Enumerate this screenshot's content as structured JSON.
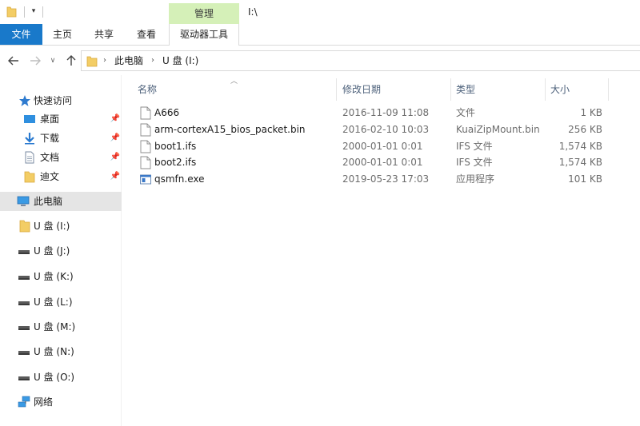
{
  "titlebar": {
    "context_tab_label": "管理",
    "path_title": "I:\\"
  },
  "ribbon": {
    "tabs": [
      {
        "label": "文件"
      },
      {
        "label": "主页"
      },
      {
        "label": "共享"
      },
      {
        "label": "查看"
      },
      {
        "label": "驱动器工具"
      }
    ]
  },
  "address": {
    "segments": [
      "此电脑",
      "U 盘 (I:)"
    ]
  },
  "sidebar": {
    "quick_access": {
      "label": "快速访问"
    },
    "pinned": [
      {
        "label": "桌面",
        "icon": "desktop-icon"
      },
      {
        "label": "下载",
        "icon": "download-icon"
      },
      {
        "label": "文档",
        "icon": "document-icon"
      },
      {
        "label": "迪文",
        "icon": "folder-icon"
      }
    ],
    "this_pc": {
      "label": "此电脑"
    },
    "drives": [
      {
        "label": "U 盘 (I:)",
        "icon": "folder-icon"
      },
      {
        "label": "U 盘 (J:)",
        "icon": "drive-icon"
      },
      {
        "label": "U 盘 (K:)",
        "icon": "drive-icon"
      },
      {
        "label": "U 盘 (L:)",
        "icon": "drive-icon"
      },
      {
        "label": "U 盘 (M:)",
        "icon": "drive-icon"
      },
      {
        "label": "U 盘 (N:)",
        "icon": "drive-icon"
      },
      {
        "label": "U 盘 (O:)",
        "icon": "drive-icon"
      }
    ],
    "network": {
      "label": "网络"
    }
  },
  "file_list": {
    "columns": {
      "name": "名称",
      "modified": "修改日期",
      "type": "类型",
      "size": "大小"
    },
    "rows": [
      {
        "name": "A666",
        "modified": "2016-11-09 11:08",
        "type": "文件",
        "size": "1 KB",
        "icon": "file-icon"
      },
      {
        "name": "arm-cortexA15_bios_packet.bin",
        "modified": "2016-02-10 10:03",
        "type": "KuaiZipMount.bin",
        "size": "256 KB",
        "icon": "file-icon"
      },
      {
        "name": "boot1.ifs",
        "modified": "2000-01-01 0:01",
        "type": "IFS 文件",
        "size": "1,574 KB",
        "icon": "file-icon"
      },
      {
        "name": "boot2.ifs",
        "modified": "2000-01-01 0:01",
        "type": "IFS 文件",
        "size": "1,574 KB",
        "icon": "file-icon"
      },
      {
        "name": "qsmfn.exe",
        "modified": "2019-05-23 17:03",
        "type": "应用程序",
        "size": "101 KB",
        "icon": "exe-icon"
      }
    ]
  },
  "colors": {
    "file_tab": "#1979ca",
    "context_tab": "#d5f0b8",
    "selected_nav": "#e5e5e5",
    "folder": "#f3cd65"
  }
}
